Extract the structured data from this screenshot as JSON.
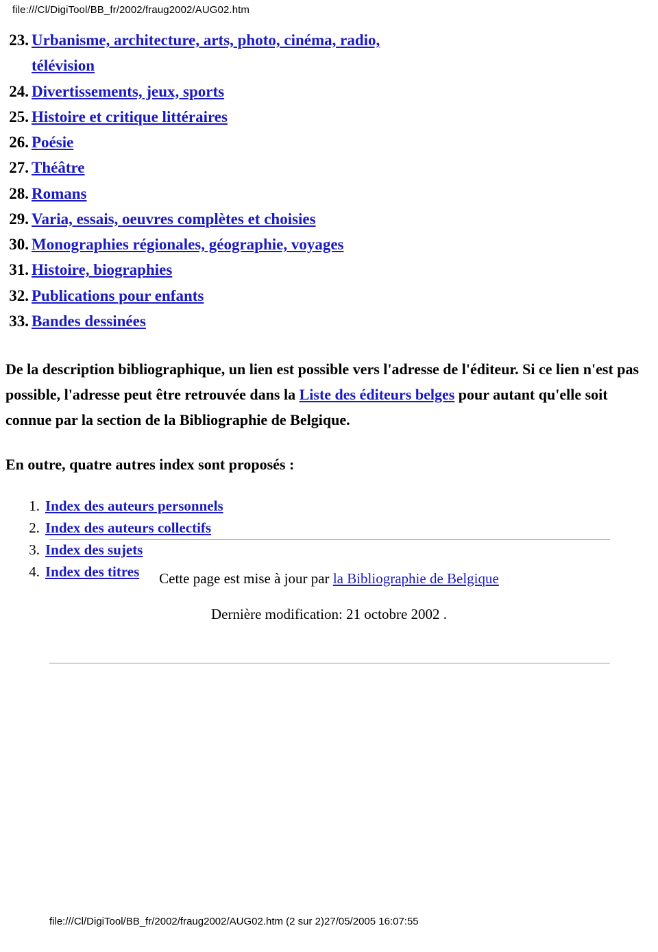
{
  "header": {
    "url": "file:///Cl/DigiTool/BB_fr/2002/fraug2002/AUG02.htm"
  },
  "toc": {
    "items": [
      {
        "num": "23.",
        "label": "Urbanisme, architecture, arts, photo, cinéma, radio, télévision",
        "link": true
      },
      {
        "num": "24.",
        "label": "Divertissements, jeux, sports",
        "link": true
      },
      {
        "num": "25.",
        "label": "Histoire et critique littéraires",
        "link": true
      },
      {
        "num": "26.",
        "label": "Poésie",
        "link": true
      },
      {
        "num": "27.",
        "label": "Théâtre",
        "link": true
      },
      {
        "num": "28.",
        "label": "Romans",
        "link": true
      },
      {
        "num": "29.",
        "label": "Varia, essais, oeuvres complètes et choisies",
        "link": true
      },
      {
        "num": "30.",
        "label": "Monographies régionales, géographie, voyages",
        "link": true
      },
      {
        "num": "31.",
        "label": "Histoire, biographies",
        "link": true
      },
      {
        "num": "32.",
        "label": "Publications pour enfants",
        "link": true
      },
      {
        "num": "33.",
        "label": "Bandes dessinées",
        "link": true
      }
    ]
  },
  "paragraphs": {
    "p1_part1": "De la description bibliographique, un lien est possible vers l'adresse de l'éditeur. Si ce lien n'est pas possible, l'adresse peut être retrouvée dans la ",
    "p1_link": "Liste des éditeurs belges",
    "p1_part2": " pour autant qu'elle soit connue par la section de la Bibliographie de Belgique.",
    "p2": "En outre, quatre autres index sont proposés :"
  },
  "index_list": {
    "items": [
      {
        "num": "1.",
        "label": "Index des auteurs personnels"
      },
      {
        "num": "2.",
        "label": "Index des auteurs collectifs"
      },
      {
        "num": "3.",
        "label": "Index des sujets"
      },
      {
        "num": "4.",
        "label": "Index des titres"
      }
    ]
  },
  "footer": {
    "maintained_prefix": "Cette page est mise à jour par ",
    "maintained_link": "la Bibliographie de Belgique",
    "last_modified": "Dernière modification: 21 octobre 2002 .",
    "bottom_url": "file:///Cl/DigiTool/BB_fr/2002/fraug2002/AUG02.htm (2 sur 2)27/05/2005 16:07:55"
  },
  "colors": {
    "link": "#1a1ac0",
    "text": "#000000",
    "rule": "#9a9a9a"
  }
}
